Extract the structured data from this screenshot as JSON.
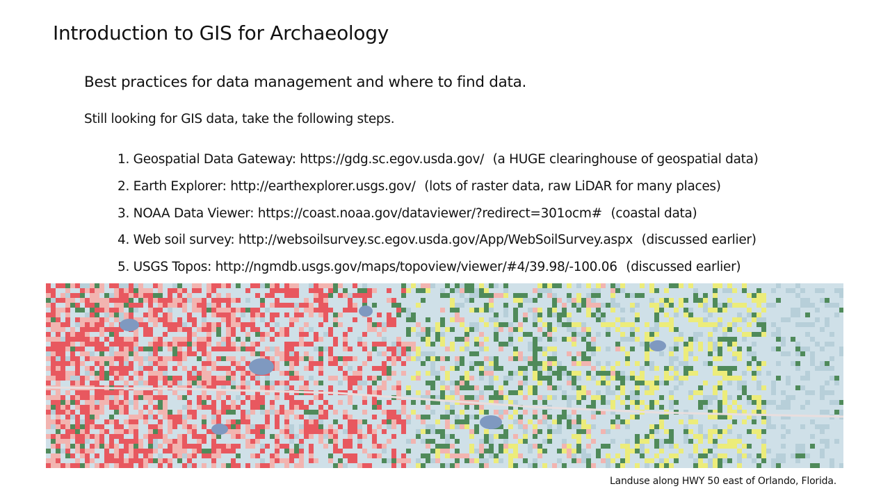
{
  "slide": {
    "title": "Introduction to GIS for Archaeology",
    "subtitle": "Best practices for data management and where to find data.",
    "lead": "Still looking for GIS data, take the following steps.",
    "steps": [
      {
        "number": "1.",
        "name": "Geospatial Data Gateway:",
        "url": "https://gdg.sc.egov.usda.gov/",
        "note": "(a HUGE clearinghouse of geospatial data)"
      },
      {
        "number": "2.",
        "name": "Earth Explorer:",
        "url": "http://earthexplorer.usgs.gov/",
        "note": "(lots of raster data, raw LiDAR for many places)"
      },
      {
        "number": "3.",
        "name": "NOAA Data Viewer:",
        "url": "https://coast.noaa.gov/dataviewer/?redirect=301ocm#",
        "note": "(coastal data)"
      },
      {
        "number": "4.",
        "name": "Web soil survey:",
        "url": "http://websoilsurvey.sc.egov.usda.gov/App/WebSoilSurvey.aspx",
        "note": "(discussed earlier)"
      },
      {
        "number": "5.",
        "name": "USGS Topos:",
        "url": "http://ngmdb.usgs.gov/maps/topoview/viewer/#4/39.98/-100.06",
        "note": "(discussed earlier)"
      }
    ],
    "map": {
      "colors": {
        "water": "#cfe0e8",
        "urban_high": "#e8585f",
        "urban_low": "#f2b4b0",
        "forest": "#4f8a5a",
        "agriculture": "#ecec7a",
        "wetland": "#b7cfd9",
        "lake": "#7f99c0"
      }
    },
    "caption": "Landuse along HWY 50 east of Orlando, Florida."
  }
}
